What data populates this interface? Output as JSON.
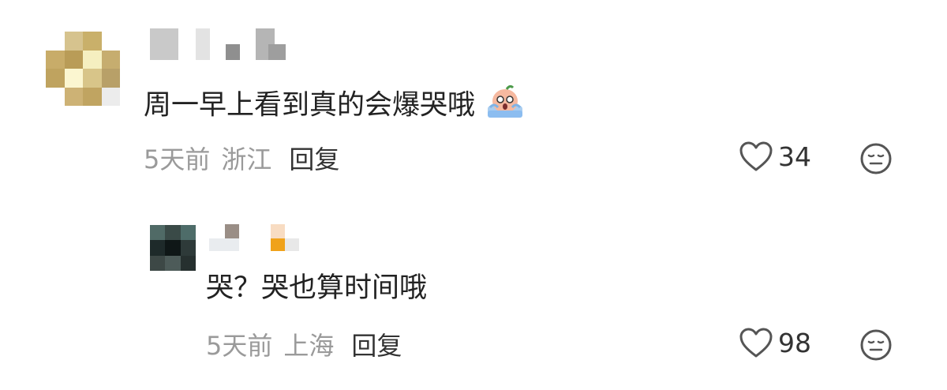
{
  "comments": [
    {
      "text": "周一早上看到真的会爆哭哦",
      "emoji": "crying-bean-emoji",
      "time": "5天前",
      "location": "浙江",
      "reply_label": "回复",
      "likes": "34"
    },
    {
      "text": "哭？哭也算时间哦",
      "time": "5天前",
      "location": "上海",
      "reply_label": "回复",
      "likes": "98"
    }
  ],
  "colors": {
    "meta_gray": "#9a9a9a",
    "text_dark": "#222222",
    "icon_gray": "#555555"
  },
  "icons": [
    "heart-icon",
    "neutral-face-icon"
  ]
}
